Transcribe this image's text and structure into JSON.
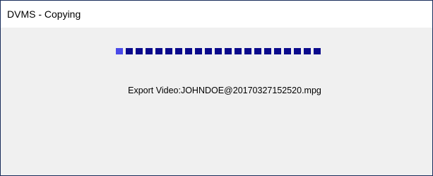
{
  "window": {
    "title": "DVMS - Copying"
  },
  "progress": {
    "segment_count": 21,
    "filled_fraction": 1.0,
    "colors": {
      "leading": "#4a4ae8",
      "segment": "#0a0a8c",
      "border": "#1a2e5c"
    }
  },
  "status": {
    "text": "Export Video:JOHNDOE@20170327152520.mpg"
  }
}
